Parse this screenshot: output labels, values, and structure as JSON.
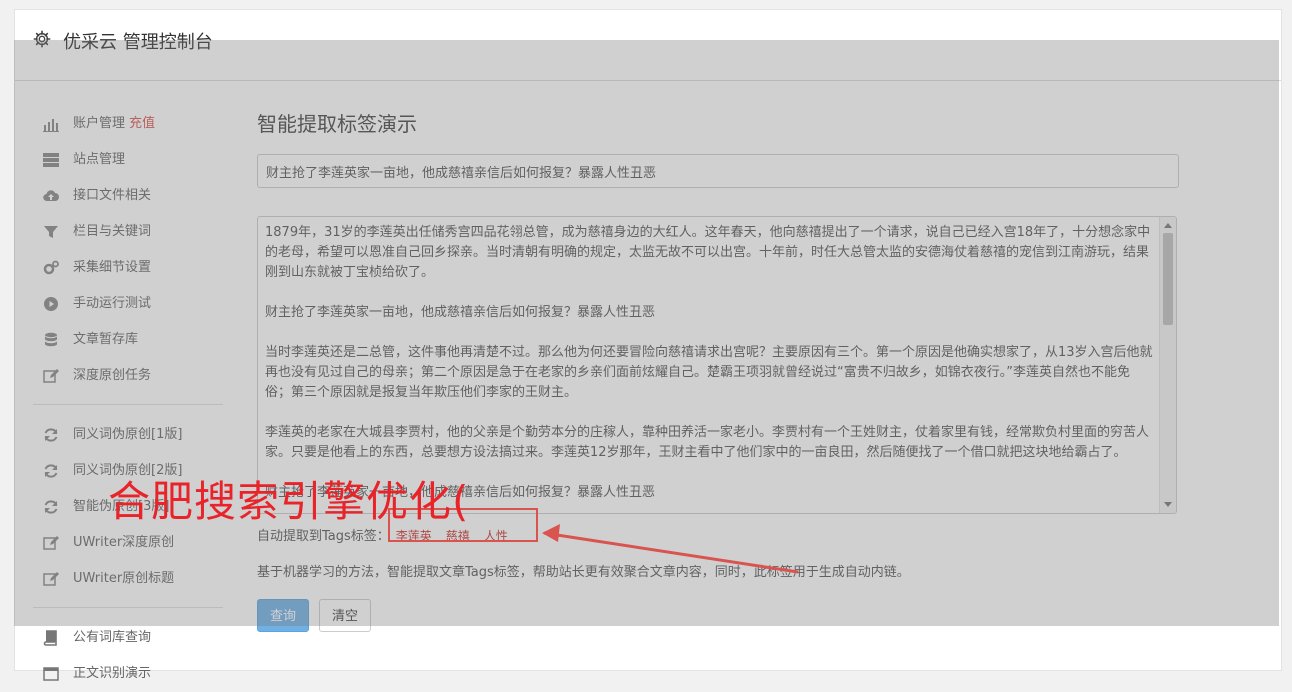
{
  "header": {
    "title": "优采云 管理控制台"
  },
  "sidebar": {
    "items": [
      {
        "label": "账户管理",
        "badge": "充值",
        "icon": "bar-chart-icon"
      },
      {
        "label": "站点管理",
        "icon": "server-icon"
      },
      {
        "label": "接口文件相关",
        "icon": "cloud-upload-icon"
      },
      {
        "label": "栏目与关键词",
        "icon": "filter-icon"
      },
      {
        "label": "采集细节设置",
        "icon": "gears-icon"
      },
      {
        "label": "手动运行测试",
        "icon": "play-circle-icon"
      },
      {
        "label": "文章暂存库",
        "icon": "database-icon"
      },
      {
        "label": "深度原创任务",
        "icon": "edit-icon"
      }
    ],
    "items2": [
      {
        "label": "同义词伪原创[1版]",
        "icon": "refresh-icon"
      },
      {
        "label": "同义词伪原创[2版]",
        "icon": "refresh-icon"
      },
      {
        "label": "智能伪原创[3版]",
        "icon": "refresh-icon"
      },
      {
        "label": "UWriter深度原创",
        "icon": "edit-icon"
      },
      {
        "label": "UWriter原创标题",
        "icon": "edit-icon"
      }
    ],
    "items3": [
      {
        "label": "公有词库查询",
        "icon": "book-icon"
      },
      {
        "label": "正文识别演示",
        "icon": "window-icon"
      }
    ]
  },
  "main": {
    "page_title": "智能提取标签演示",
    "title_input_value": "财主抢了李莲英家一亩地，他成慈禧亲信后如何报复？暴露人性丑恶",
    "body_paragraphs": [
      "1879年，31岁的李莲英出任储秀宫四品花翎总管，成为慈禧身边的大红人。这年春天，他向慈禧提出了一个请求，说自己已经入宫18年了，十分想念家中的老母，希望可以恩准自己回乡探亲。当时清朝有明确的规定，太监无故不可以出宫。十年前，时任大总管太监的安德海仗着慈禧的宠信到江南游玩，结果刚到山东就被丁宝桢给砍了。",
      "财主抢了李莲英家一亩地，他成慈禧亲信后如何报复？暴露人性丑恶",
      "当时李莲英还是二总管，这件事他再清楚不过。那么他为何还要冒险向慈禧请求出宫呢？主要原因有三个。第一个原因是他确实想家了，从13岁入宫后他就再也没有见过自己的母亲；第二个原因是急于在老家的乡亲们面前炫耀自己。楚霸王项羽就曾经说过“富贵不归故乡，如锦衣夜行。”李莲英自然也不能免俗；第三个原因就是报复当年欺压他们李家的王财主。",
      "李莲英的老家在大城县李贾村，他的父亲是个勤劳本分的庄稼人，靠种田养活一家老小。李贾村有一个王姓财主，仗着家里有钱，经常欺负村里面的穷苦人家。只要是他看上的东西，总要想方设法搞过来。李莲英12岁那年，王财主看中了他们家中的一亩良田，然后随便找了一个借口就把这块地给霸占了。",
      "财主抢了李莲英家一亩地，他成慈禧亲信后如何报复？暴露人性丑恶"
    ],
    "tags_label": "自动提取到Tags标签：",
    "tags": [
      "李莲英",
      "慈禧",
      "人性"
    ],
    "description": "基于机器学习的方法，智能提取文章Tags标签，帮助站长更有效聚合文章内容，同时，此标签用于生成自动内链。",
    "query_button": "查询",
    "clear_button": "清空"
  },
  "annotation": {
    "watermark_text": "合肥搜索引擎优化("
  },
  "colors": {
    "accent": "#6fb1e5",
    "tag": "#c9302c",
    "annotation": "#e8242a"
  }
}
